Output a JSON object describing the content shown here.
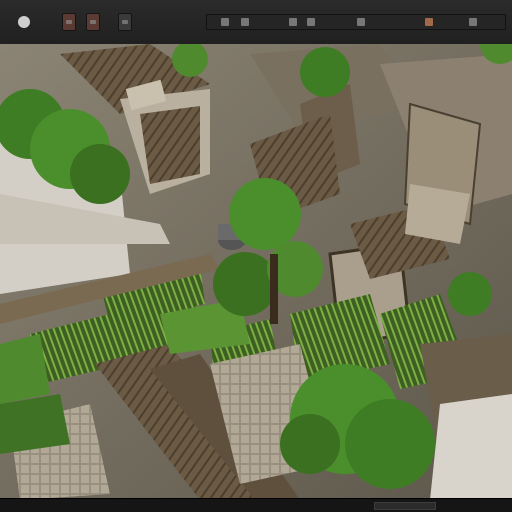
{
  "toolbar": {
    "items": [
      "record-dot",
      "transform-tool",
      "scale-tool",
      "layer-tool"
    ],
    "accent": "#5a3a32"
  },
  "sidepanel": {
    "glyph": "⸰"
  },
  "viewport": {
    "scene": "isometric-ruins-terrain",
    "colors": {
      "stone": "#8a7f6b",
      "wood": "#6a5a44",
      "grass": "#4f8a2e",
      "foliage": "#3e7d24"
    }
  },
  "status": {
    "field": ""
  }
}
